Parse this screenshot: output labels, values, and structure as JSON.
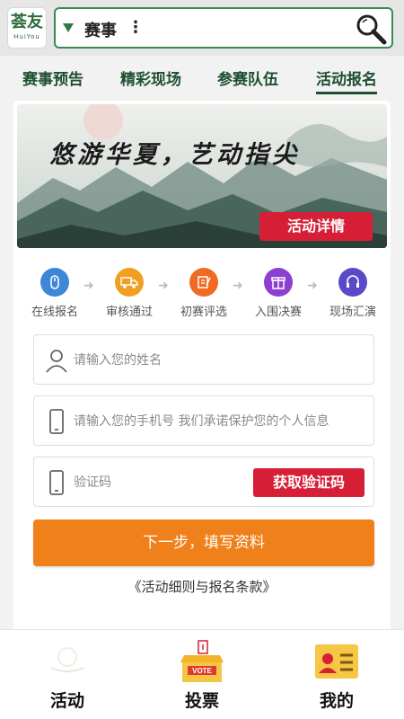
{
  "header": {
    "logo_text": "荟友",
    "logo_sub": "HuiYou",
    "search_category": "赛事",
    "menu_glyph": "⋮",
    "search_icon": "search-icon"
  },
  "tabs": [
    {
      "label": "赛事预告",
      "active": false
    },
    {
      "label": "精彩现场",
      "active": false
    },
    {
      "label": "参赛队伍",
      "active": false
    },
    {
      "label": "活动报名",
      "active": true
    }
  ],
  "banner": {
    "calligraphy": "悠游华夏，艺动指尖",
    "detail_button": "活动详情"
  },
  "steps": [
    {
      "label": "在线报名",
      "icon": "mouse-icon",
      "color": "#3e86d8"
    },
    {
      "label": "审核通过",
      "icon": "truck-icon",
      "color": "#f0a020"
    },
    {
      "label": "初赛评选",
      "icon": "edit-icon",
      "color": "#ef6a23"
    },
    {
      "label": "入围决赛",
      "icon": "gift-icon",
      "color": "#8c3fd0"
    },
    {
      "label": "现场汇演",
      "icon": "headset-icon",
      "color": "#5a49c9"
    }
  ],
  "step_arrow": "➜",
  "form": {
    "name_placeholder": "请输入您的姓名",
    "phone_placeholder": "请输入您的手机号 我们承诺保护您的个人信息",
    "code_placeholder": "验证码",
    "get_code_button": "获取验证码",
    "next_button": "下一步，填写资料",
    "terms_link": "《活动细则与报名条款》"
  },
  "bottom_nav": [
    {
      "label": "活动",
      "icon": "activity-icon"
    },
    {
      "label": "投票",
      "icon": "vote-box-icon",
      "badge": "VOTE"
    },
    {
      "label": "我的",
      "icon": "profile-card-icon"
    }
  ],
  "colors": {
    "brand_green": "#1d5030",
    "accent_red": "#d61f36",
    "accent_orange": "#f0801a"
  }
}
